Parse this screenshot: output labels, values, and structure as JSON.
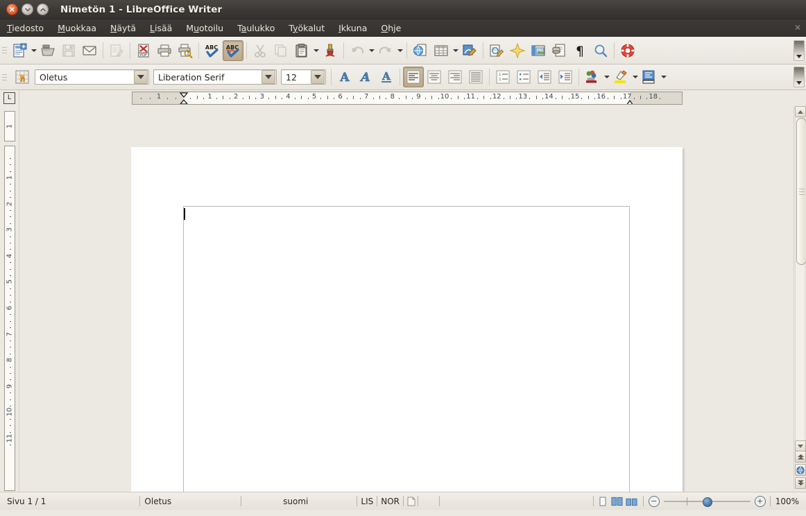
{
  "window": {
    "title": "Nimetön 1 - LibreOffice Writer",
    "buttons": {
      "close": "close-button",
      "minimize": "minimize-button",
      "maximize": "maximize-button"
    }
  },
  "menubar": {
    "items": [
      {
        "label": "Tiedosto",
        "accel": "T",
        "name": "menu-tiedosto"
      },
      {
        "label": "Muokkaa",
        "accel": "M",
        "name": "menu-muokkaa"
      },
      {
        "label": "Näytä",
        "accel": "N",
        "name": "menu-naytä"
      },
      {
        "label": "Lisää",
        "accel": "L",
        "name": "menu-lisaa"
      },
      {
        "label": "Muotoilu",
        "accel": "u",
        "name": "menu-muotoilu"
      },
      {
        "label": "Taulukko",
        "accel": "a",
        "name": "menu-taulukko"
      },
      {
        "label": "Työkalut",
        "accel": "y",
        "name": "menu-tyokalut"
      },
      {
        "label": "Ikkuna",
        "accel": "I",
        "name": "menu-ikkuna"
      },
      {
        "label": "Ohje",
        "accel": "O",
        "name": "menu-ohje"
      }
    ],
    "close_doc": "✕"
  },
  "standard_toolbar": {
    "items": [
      {
        "name": "new-document-icon",
        "label": "Uusi",
        "state": "enabled"
      },
      {
        "name": "new-document-dropdown",
        "label": "Uusi (valikko)",
        "state": "enabled"
      },
      {
        "name": "open-file-icon",
        "label": "Avaa",
        "state": "enabled"
      },
      {
        "name": "save-icon",
        "label": "Tallenna",
        "state": "disabled"
      },
      {
        "name": "email-document-icon",
        "label": "Lähetä sähköpostilla",
        "state": "enabled"
      },
      {
        "name": "edit-mode-icon",
        "label": "Muokkaustila",
        "state": "disabled"
      },
      {
        "name": "export-pdf-icon",
        "label": "Vie suoraan PDF:nä",
        "state": "enabled"
      },
      {
        "name": "print-icon",
        "label": "Tulosta",
        "state": "enabled"
      },
      {
        "name": "print-preview-icon",
        "label": "Esikatselu",
        "state": "enabled"
      },
      {
        "name": "spelling-icon",
        "label": "Oikoluku",
        "state": "enabled"
      },
      {
        "name": "autospellcheck-icon",
        "label": "Automaattinen oikoluku",
        "state": "active"
      },
      {
        "name": "cut-icon",
        "label": "Leikkaa",
        "state": "disabled"
      },
      {
        "name": "copy-icon",
        "label": "Kopioi",
        "state": "disabled"
      },
      {
        "name": "paste-icon",
        "label": "Liitä",
        "state": "enabled"
      },
      {
        "name": "paste-dropdown",
        "label": "Liitä (valikko)",
        "state": "enabled"
      },
      {
        "name": "clone-formatting-icon",
        "label": "Kopioi muotoilu",
        "state": "enabled"
      },
      {
        "name": "undo-icon",
        "label": "Kumoa",
        "state": "disabled"
      },
      {
        "name": "undo-dropdown",
        "label": "Kumoa (valikko)",
        "state": "enabled"
      },
      {
        "name": "redo-icon",
        "label": "Tee uudelleen",
        "state": "disabled"
      },
      {
        "name": "redo-dropdown",
        "label": "Tee uudelleen (valikko)",
        "state": "enabled"
      },
      {
        "name": "hyperlink-icon",
        "label": "Hyperlinkki",
        "state": "enabled"
      },
      {
        "name": "insert-table-icon",
        "label": "Taulukko",
        "state": "enabled"
      },
      {
        "name": "insert-table-dropdown",
        "label": "Taulukko (valikko)",
        "state": "enabled"
      },
      {
        "name": "show-draw-functions-icon",
        "label": "Piirtotoiminnot",
        "state": "enabled"
      },
      {
        "name": "find-replace-icon",
        "label": "Etsi ja korvaa",
        "state": "enabled"
      },
      {
        "name": "gallery-icon",
        "label": "Galleria",
        "state": "enabled"
      },
      {
        "name": "insert-image-icon",
        "label": "Kuva",
        "state": "enabled"
      },
      {
        "name": "data-sources-icon",
        "label": "Tietolähteet",
        "state": "enabled"
      },
      {
        "name": "formatting-marks-icon",
        "label": "Muotoilumerkit",
        "state": "enabled"
      },
      {
        "name": "zoom-icon",
        "label": "Zoomaus",
        "state": "enabled"
      },
      {
        "name": "help-icon",
        "label": "Ohje",
        "state": "enabled"
      },
      {
        "name": "toolbar-overflow",
        "label": "Lisää painikkeita",
        "state": "enabled"
      }
    ]
  },
  "formatting_toolbar": {
    "paragraph_style": {
      "value": "Oletus",
      "name": "paragraph-style-combo"
    },
    "font_name": {
      "value": "Liberation Serif",
      "name": "font-name-combo"
    },
    "font_size": {
      "value": "12",
      "name": "font-size-combo"
    },
    "styles_icon": "apply-style-icon",
    "buttons": [
      {
        "name": "bold-button",
        "label": "Lihavointi",
        "state": "enabled"
      },
      {
        "name": "italic-button",
        "label": "Kursivointi",
        "state": "enabled"
      },
      {
        "name": "underline-button",
        "label": "Alleviivaus",
        "state": "enabled"
      },
      {
        "name": "align-left-button",
        "label": "Tasaa vasemmalle",
        "state": "active"
      },
      {
        "name": "align-center-button",
        "label": "Keskitä",
        "state": "enabled"
      },
      {
        "name": "align-right-button",
        "label": "Tasaa oikealle",
        "state": "enabled"
      },
      {
        "name": "justify-button",
        "label": "Tasaa molemmat reunat",
        "state": "enabled"
      },
      {
        "name": "ordered-list-button",
        "label": "Numeroitu luettelo",
        "state": "enabled"
      },
      {
        "name": "unordered-list-button",
        "label": "Luettelomerkit",
        "state": "enabled"
      },
      {
        "name": "decrease-indent-button",
        "label": "Pienennä sisennystä",
        "state": "enabled"
      },
      {
        "name": "increase-indent-button",
        "label": "Suurenna sisennystä",
        "state": "enabled"
      },
      {
        "name": "font-color-button",
        "label": "Fontin väri",
        "state": "enabled"
      },
      {
        "name": "highlight-color-button",
        "label": "Korostusväri",
        "state": "enabled"
      },
      {
        "name": "paragraph-background-button",
        "label": "Kappaleen taustaväri",
        "state": "enabled"
      }
    ]
  },
  "ruler": {
    "tab_selector": "L",
    "horizontal_numbers": [
      "1",
      "1",
      "2",
      "3",
      "4",
      "5",
      "6",
      "7",
      "8",
      "9",
      "10",
      "11",
      "12",
      "13",
      "14",
      "15",
      "16",
      "17",
      "18"
    ],
    "vertical_numbers": [
      "1",
      "1",
      "2",
      "3",
      "4",
      "5",
      "6",
      "7",
      "8",
      "9",
      "10",
      "11"
    ],
    "unit": "cm"
  },
  "document": {
    "page_count": 1,
    "content": "",
    "cursor_visible": true
  },
  "statusbar": {
    "page": "Sivu 1 / 1",
    "page_style": "Oletus",
    "language": "suomi",
    "insert_mode": "LIS",
    "selection_mode": "NOR",
    "unsaved_icon": "document-modified-icon",
    "zoom_level": "100%",
    "view_buttons": [
      {
        "name": "single-page-view-button",
        "label": "Yksi sivu"
      },
      {
        "name": "multi-page-view-button",
        "label": "Usea sivu"
      },
      {
        "name": "book-view-button",
        "label": "Kirjanäkymä"
      }
    ],
    "zoom_out": "−",
    "zoom_in": "+"
  },
  "scrollbar": {
    "up": "scroll-up-button",
    "down": "scroll-down-button",
    "previous_page": "previous-page-button",
    "navigation": "navigation-button",
    "next_page": "next-page-button"
  },
  "colors": {
    "titlebar": "#3b3835",
    "toolbar": "#ece9e3",
    "workspace": "#ece9e3",
    "page": "#ffffff",
    "accent_blue": "#3f6f9f"
  }
}
